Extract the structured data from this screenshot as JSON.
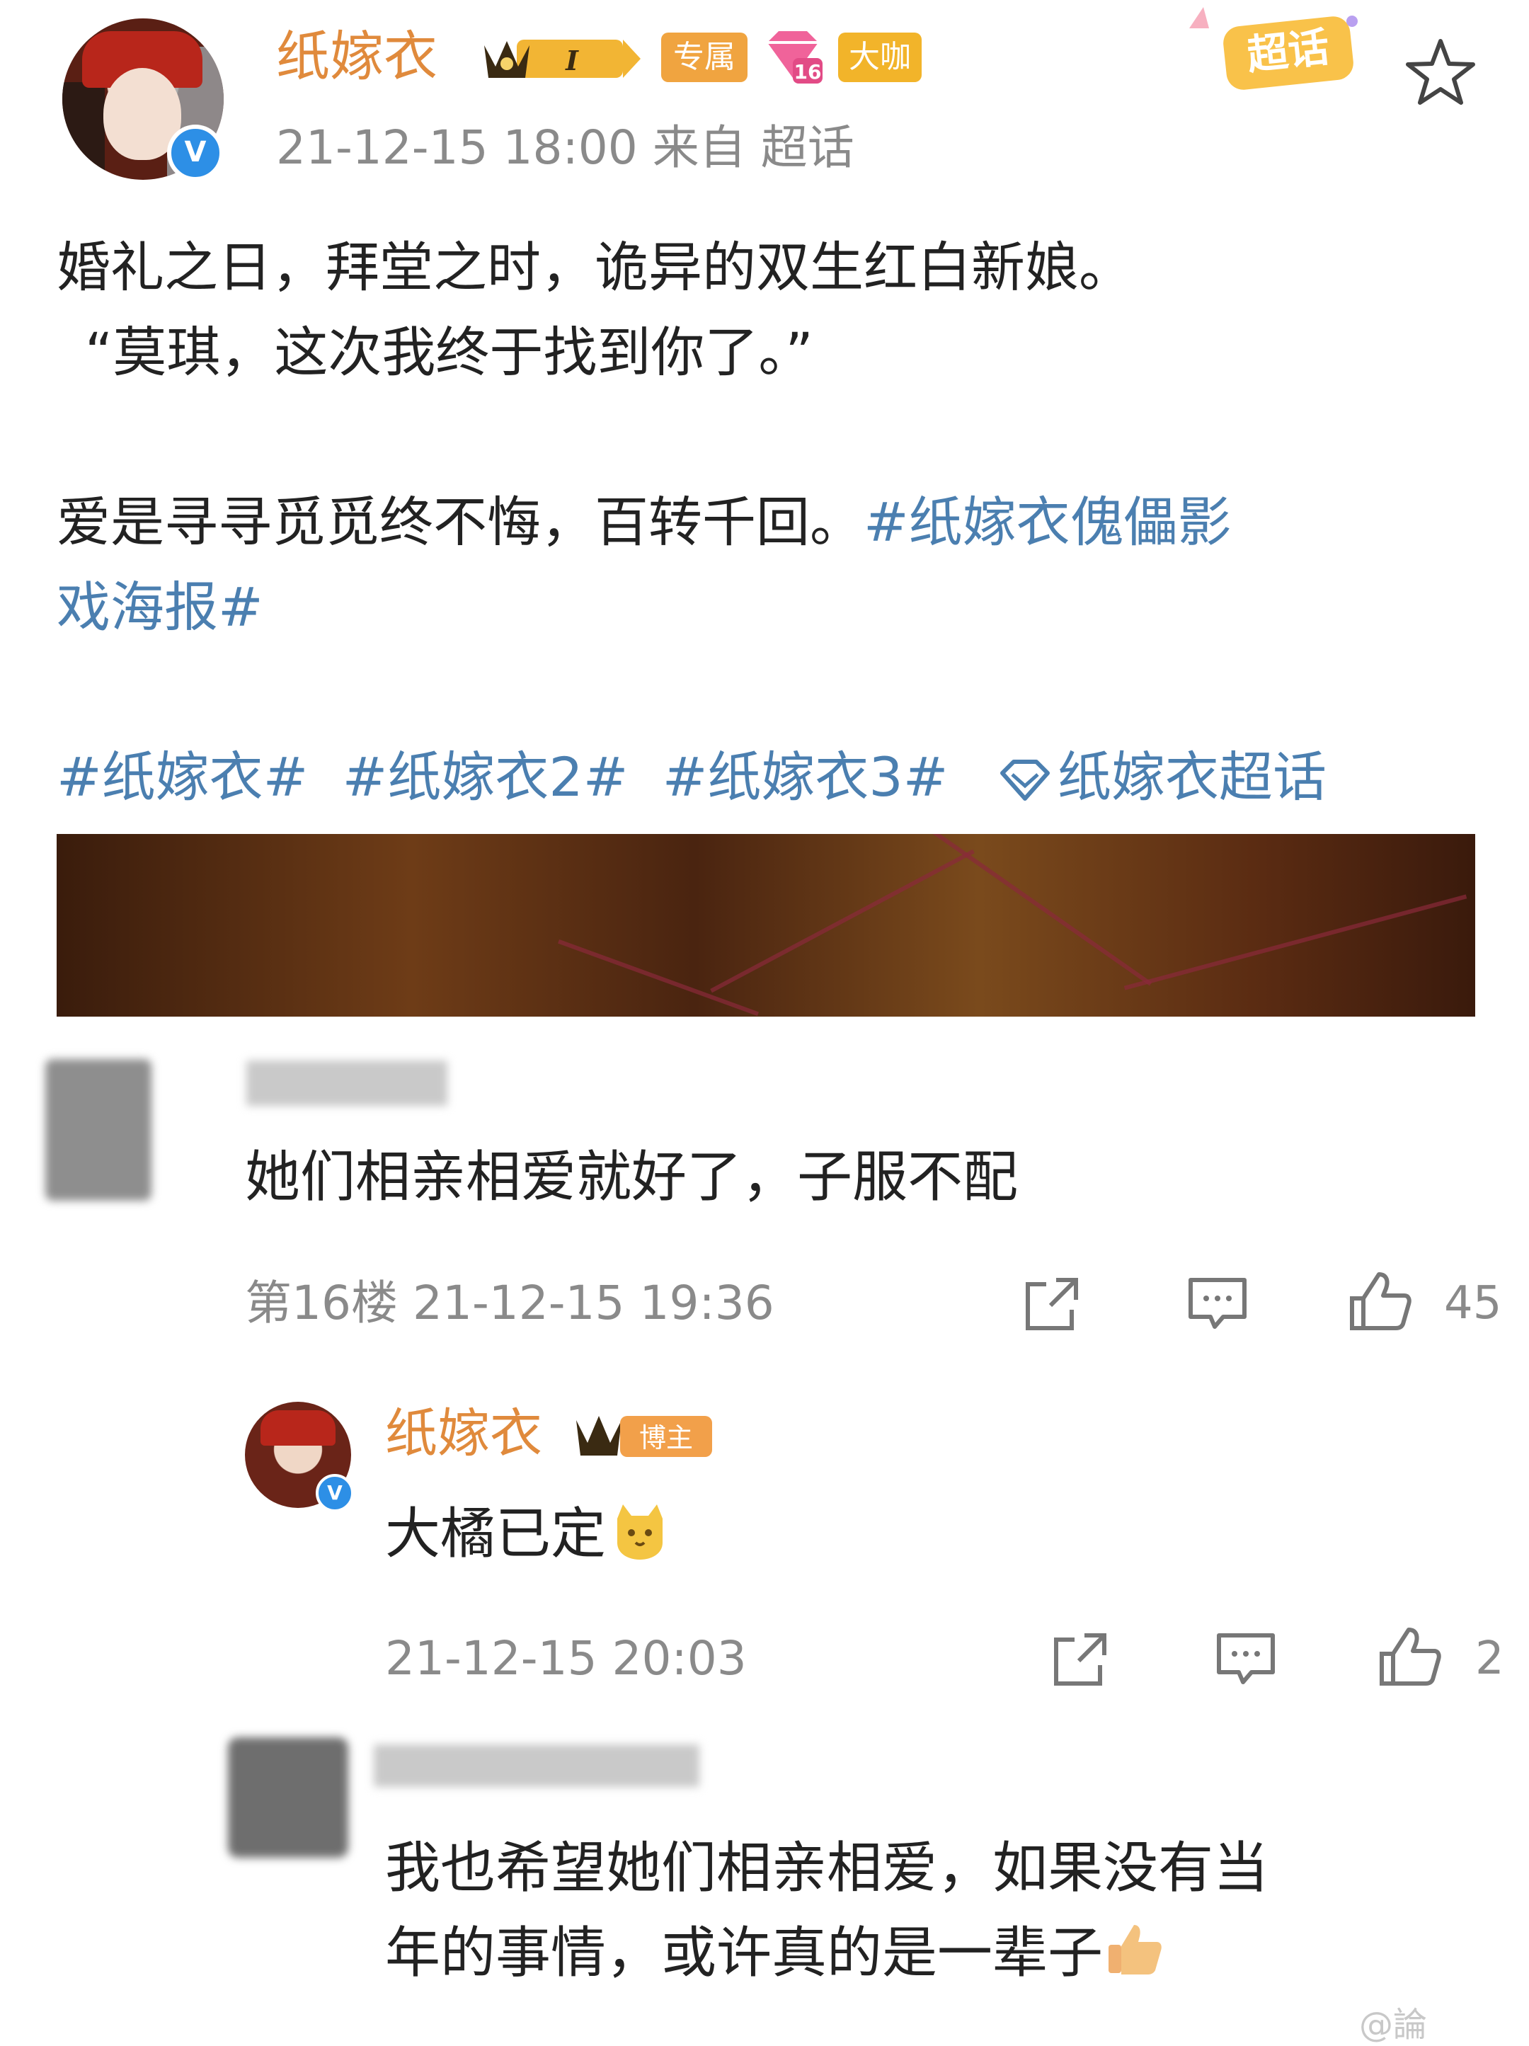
{
  "post": {
    "username": "纸嫁衣",
    "crown_level": "I",
    "badges": [
      "专属",
      "大咖"
    ],
    "level_badge": "16",
    "supertopic_label": "超话",
    "meta": "21-12-15 18:00   来自  超话",
    "lines": [
      "婚礼之日，拜堂之时，诡异的双生红白新娘。",
      "“莫琪，这次我终于找到你了。”"
    ],
    "line3_plain": "爱是寻寻觅觅终不悔，百转千回。",
    "line3_tag": "#纸嫁衣傀儡影",
    "line4_tag": "戏海报#",
    "tags_line": "#纸嫁衣#  #纸嫁衣2#  #纸嫁衣3#",
    "supertopic_link": "纸嫁衣超话"
  },
  "comments": [
    {
      "text": "她们相亲相爱就好了，子服不配",
      "meta": "第16楼  21-12-15 19:36",
      "likes": "45"
    }
  ],
  "reply": {
    "username": "纸嫁衣",
    "badge": "博主",
    "text": "大橘已定",
    "meta": "21-12-15 20:03",
    "likes": "2"
  },
  "comment2": {
    "line1": "我也希望她们相亲相爱，如果没有当",
    "line2": "年的事情，或许真的是一辈子"
  },
  "watermark": "@論",
  "colors": {
    "username": "#e08a3c",
    "link": "#4b7fb0",
    "meta": "#8a8a8a",
    "verified": "#2d8fe6"
  },
  "icons": [
    "star-icon",
    "share-icon",
    "comment-icon",
    "like-icon",
    "verified-icon",
    "crown-icon",
    "diamond-icon"
  ]
}
